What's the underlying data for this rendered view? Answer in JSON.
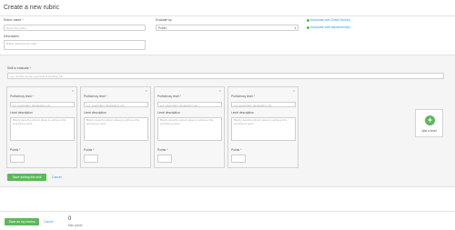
{
  "header": {
    "title": "Create a new rubric"
  },
  "form": {
    "rubric_name_label": "Rubric name",
    "rubric_name_placeholder": "Name this rubric",
    "evaluate_by_label": "Evaluate by",
    "evaluate_by_value": "Points",
    "description_label": "Description",
    "description_placeholder": "Briefly describe the rubric",
    "associate_grade_levels": "Associate with Grade level(s)",
    "associate_departments": "Associate with department(s)",
    "required_mark": "*"
  },
  "skill": {
    "label": "Skill to evaluate",
    "placeholder": "e.g. number sense, grammar & spelling, etc.",
    "save_button": "Save adding this skill",
    "cancel": "Cancel"
  },
  "levels": [
    {
      "proficiency_label": "Proficiency level",
      "proficiency_placeholder": "e.g. exemplary, developing, etc.",
      "description_label": "Level description",
      "description_placeholder": "Briefly describe what it takes to achieve this proficiency level",
      "points_label": "Points",
      "close": "×"
    },
    {
      "proficiency_label": "Proficiency level",
      "proficiency_placeholder": "e.g. exemplary, developing, etc.",
      "description_label": "Level description",
      "description_placeholder": "Briefly describe what it takes to achieve this proficiency level",
      "points_label": "Points",
      "close": "×"
    },
    {
      "proficiency_label": "Proficiency level",
      "proficiency_placeholder": "e.g. exemplary, developing, etc.",
      "description_label": "Level description",
      "description_placeholder": "Briefly describe what it takes to achieve this proficiency level",
      "points_label": "Points",
      "close": "×"
    },
    {
      "proficiency_label": "Proficiency level",
      "proficiency_placeholder": "e.g. exemplary, developing, etc.",
      "description_label": "Level description",
      "description_placeholder": "Briefly describe what it takes to achieve this proficiency level",
      "points_label": "Points",
      "close": "×"
    }
  ],
  "add_level": {
    "icon": "plus-icon",
    "label": "Add a level"
  },
  "footer": {
    "save_button": "Save as my rubrics",
    "cancel": "Cancel",
    "max_points_value": "0",
    "max_points_label": "Max points"
  },
  "colors": {
    "accent_green": "#5cb85c",
    "link_blue": "#3a9ad9",
    "required_red": "#d9534f"
  }
}
